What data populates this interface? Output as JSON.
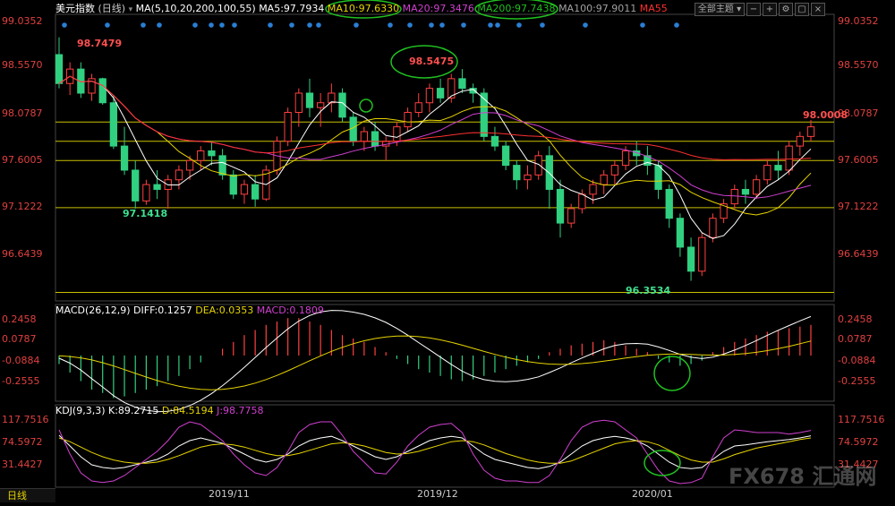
{
  "header": {
    "symbol": "美元指数",
    "period": "日线",
    "ma_label": "MA(5,10,20,200,100,55)",
    "ma5": "MA5:97.7934",
    "ma10": "MA10:97.6330",
    "ma20": "MA20:97.3476",
    "ma200": "MA200:97.7438",
    "ma100": "MA100:97.9011",
    "ma55": "MA55",
    "topic_button": "全部主题",
    "colors": {
      "ma5": "#ffffff",
      "ma10": "#e6d400",
      "ma20": "#d040d0",
      "ma200": "#20c020",
      "ma100": "#a0a0a0",
      "ma55": "#ff3030",
      "up": "#ff4040",
      "down": "#30d080"
    }
  },
  "price_axis": [
    "99.0352",
    "98.5570",
    "98.0787",
    "97.6005",
    "97.1222",
    "96.6439"
  ],
  "macd_header": {
    "name": "MACD(26,12,9)",
    "diff": "DIFF:0.1257",
    "dea": "DEA:0.0353",
    "macd": "MACD:0.1809"
  },
  "macd_axis": [
    "0.2458",
    "0.0787",
    "-0.0884",
    "-0.2555"
  ],
  "kdj_header": {
    "name": "KDJ(9,3,3)",
    "k": "K:89.2715",
    "d": "D:84.5194",
    "j": "J:98.7758"
  },
  "kdj_axis": [
    "117.7516",
    "74.5972",
    "31.4427"
  ],
  "x_labels": [
    "2019/11",
    "2019/12",
    "2020/01"
  ],
  "annotations": [
    "98.7479",
    "98.5475",
    "98.0008",
    "97.1418",
    "96.3534"
  ],
  "bottom_tab": "日线",
  "watermark": "FX678 汇通网",
  "chart_data": {
    "type": "candlestick",
    "ylim": [
      96.16,
      99.1
    ],
    "x_ticks": [
      {
        "index": 43,
        "label": "2019/11"
      },
      {
        "index": 100,
        "label": "2019/12"
      },
      {
        "index": 158,
        "label": "2020/01"
      }
    ],
    "horizontal_levels": [
      98.0,
      97.8,
      97.6,
      97.11,
      96.23
    ],
    "candles": [
      [
        98.7,
        98.88,
        98.35,
        98.4
      ],
      [
        98.4,
        98.62,
        98.28,
        98.55
      ],
      [
        98.55,
        98.62,
        98.25,
        98.3
      ],
      [
        98.3,
        98.5,
        98.22,
        98.45
      ],
      [
        98.45,
        98.46,
        98.18,
        98.2
      ],
      [
        98.2,
        98.28,
        97.72,
        97.75
      ],
      [
        97.75,
        97.95,
        97.45,
        97.5
      ],
      [
        97.5,
        97.6,
        97.1,
        97.18
      ],
      [
        97.18,
        97.4,
        97.14,
        97.35
      ],
      [
        97.35,
        97.5,
        97.2,
        97.3
      ],
      [
        97.3,
        97.45,
        97.1,
        97.4
      ],
      [
        97.4,
        97.55,
        97.3,
        97.5
      ],
      [
        97.5,
        97.65,
        97.4,
        97.6
      ],
      [
        97.6,
        97.75,
        97.5,
        97.7
      ],
      [
        97.7,
        97.8,
        97.55,
        97.65
      ],
      [
        97.65,
        97.72,
        97.4,
        97.45
      ],
      [
        97.45,
        97.5,
        97.2,
        97.25
      ],
      [
        97.25,
        97.4,
        97.15,
        97.35
      ],
      [
        97.35,
        97.45,
        97.12,
        97.2
      ],
      [
        97.2,
        97.55,
        97.18,
        97.5
      ],
      [
        97.5,
        97.85,
        97.45,
        97.8
      ],
      [
        97.8,
        98.15,
        97.75,
        98.1
      ],
      [
        98.1,
        98.35,
        97.95,
        98.3
      ],
      [
        98.3,
        98.45,
        98.05,
        98.15
      ],
      [
        98.15,
        98.3,
        97.95,
        98.2
      ],
      [
        98.2,
        98.4,
        98.1,
        98.3
      ],
      [
        98.3,
        98.35,
        98.0,
        98.05
      ],
      [
        98.05,
        98.1,
        97.75,
        97.8
      ],
      [
        97.8,
        97.95,
        97.7,
        97.9
      ],
      [
        97.9,
        98.0,
        97.7,
        97.75
      ],
      [
        97.75,
        97.85,
        97.6,
        97.8
      ],
      [
        97.8,
        98.0,
        97.75,
        97.95
      ],
      [
        97.95,
        98.15,
        97.9,
        98.1
      ],
      [
        98.1,
        98.3,
        98.05,
        98.2
      ],
      [
        98.2,
        98.4,
        98.1,
        98.35
      ],
      [
        98.35,
        98.45,
        98.2,
        98.25
      ],
      [
        98.25,
        98.5,
        98.2,
        98.45
      ],
      [
        98.45,
        98.55,
        98.3,
        98.35
      ],
      [
        98.35,
        98.4,
        98.2,
        98.3
      ],
      [
        98.3,
        98.35,
        97.8,
        97.85
      ],
      [
        97.85,
        97.95,
        97.7,
        97.75
      ],
      [
        97.75,
        97.8,
        97.5,
        97.55
      ],
      [
        97.55,
        97.6,
        97.3,
        97.4
      ],
      [
        97.4,
        97.55,
        97.3,
        97.45
      ],
      [
        97.45,
        97.7,
        97.4,
        97.65
      ],
      [
        97.65,
        97.75,
        97.1,
        97.3
      ],
      [
        97.3,
        97.4,
        96.8,
        96.95
      ],
      [
        96.95,
        97.15,
        96.9,
        97.1
      ],
      [
        97.1,
        97.3,
        97.05,
        97.25
      ],
      [
        97.25,
        97.4,
        97.15,
        97.35
      ],
      [
        97.35,
        97.5,
        97.25,
        97.45
      ],
      [
        97.45,
        97.6,
        97.35,
        97.55
      ],
      [
        97.55,
        97.75,
        97.5,
        97.7
      ],
      [
        97.7,
        97.8,
        97.55,
        97.65
      ],
      [
        97.65,
        97.75,
        97.45,
        97.55
      ],
      [
        97.55,
        97.6,
        97.2,
        97.3
      ],
      [
        97.3,
        97.35,
        96.9,
        97.0
      ],
      [
        97.0,
        97.05,
        96.6,
        96.7
      ],
      [
        96.7,
        96.8,
        96.35,
        96.45
      ],
      [
        96.45,
        96.85,
        96.4,
        96.8
      ],
      [
        96.8,
        97.05,
        96.75,
        97.0
      ],
      [
        97.0,
        97.2,
        96.95,
        97.15
      ],
      [
        97.15,
        97.35,
        97.1,
        97.3
      ],
      [
        97.3,
        97.4,
        97.15,
        97.25
      ],
      [
        97.25,
        97.45,
        97.2,
        97.4
      ],
      [
        97.4,
        97.6,
        97.35,
        97.55
      ],
      [
        97.55,
        97.7,
        97.4,
        97.5
      ],
      [
        97.5,
        97.8,
        97.45,
        97.75
      ],
      [
        97.75,
        97.9,
        97.65,
        97.85
      ],
      [
        97.85,
        98.02,
        97.8,
        97.95
      ]
    ],
    "macd_hist": [
      -0.05,
      -0.1,
      -0.15,
      -0.2,
      -0.22,
      -0.25,
      -0.24,
      -0.22,
      -0.2,
      -0.18,
      -0.15,
      -0.12,
      -0.08,
      -0.04,
      0,
      0.04,
      0.08,
      0.12,
      0.15,
      0.18,
      0.2,
      0.22,
      0.22,
      0.2,
      0.18,
      0.15,
      0.12,
      0.1,
      0.08,
      0.05,
      0.02,
      -0.02,
      -0.05,
      -0.08,
      -0.1,
      -0.12,
      -0.14,
      -0.15,
      -0.14,
      -0.12,
      -0.1,
      -0.08,
      -0.06,
      -0.04,
      -0.02,
      0.02,
      0.04,
      0.06,
      0.07,
      0.08,
      0.09,
      0.08,
      0.06,
      0.04,
      0.02,
      -0.02,
      -0.04,
      -0.06,
      -0.05,
      -0.03,
      0.02,
      0.05,
      0.08,
      0.1,
      0.12,
      0.14,
      0.15,
      0.16,
      0.17,
      0.18
    ],
    "kdj_k": [
      90,
      70,
      50,
      35,
      30,
      28,
      30,
      35,
      40,
      45,
      55,
      70,
      80,
      85,
      80,
      75,
      65,
      55,
      45,
      40,
      45,
      55,
      70,
      80,
      85,
      88,
      80,
      70,
      60,
      50,
      45,
      50,
      60,
      70,
      80,
      85,
      88,
      85,
      70,
      55,
      45,
      40,
      35,
      30,
      28,
      32,
      40,
      55,
      70,
      80,
      85,
      88,
      85,
      80,
      70,
      55,
      40,
      30,
      28,
      30,
      45,
      60,
      70,
      72,
      75,
      78,
      80,
      82,
      85,
      89
    ],
    "kdj_d": [
      85,
      78,
      68,
      58,
      50,
      44,
      40,
      38,
      38,
      40,
      45,
      52,
      60,
      68,
      72,
      74,
      72,
      68,
      62,
      56,
      52,
      52,
      56,
      62,
      68,
      74,
      76,
      74,
      70,
      64,
      58,
      55,
      56,
      60,
      66,
      72,
      78,
      80,
      78,
      72,
      64,
      56,
      50,
      44,
      40,
      38,
      38,
      42,
      50,
      58,
      66,
      74,
      78,
      80,
      78,
      72,
      62,
      52,
      44,
      40,
      40,
      46,
      54,
      60,
      66,
      70,
      74,
      78,
      82,
      85
    ],
    "kdj_j": [
      100,
      55,
      20,
      5,
      2,
      5,
      15,
      30,
      45,
      60,
      80,
      105,
      115,
      110,
      95,
      80,
      55,
      35,
      20,
      15,
      30,
      60,
      95,
      110,
      115,
      115,
      90,
      60,
      40,
      20,
      18,
      40,
      70,
      90,
      105,
      110,
      112,
      95,
      55,
      25,
      10,
      5,
      5,
      2,
      2,
      15,
      45,
      80,
      105,
      115,
      118,
      115,
      100,
      85,
      55,
      25,
      5,
      0,
      2,
      10,
      50,
      85,
      100,
      98,
      95,
      95,
      95,
      92,
      95,
      99
    ]
  }
}
